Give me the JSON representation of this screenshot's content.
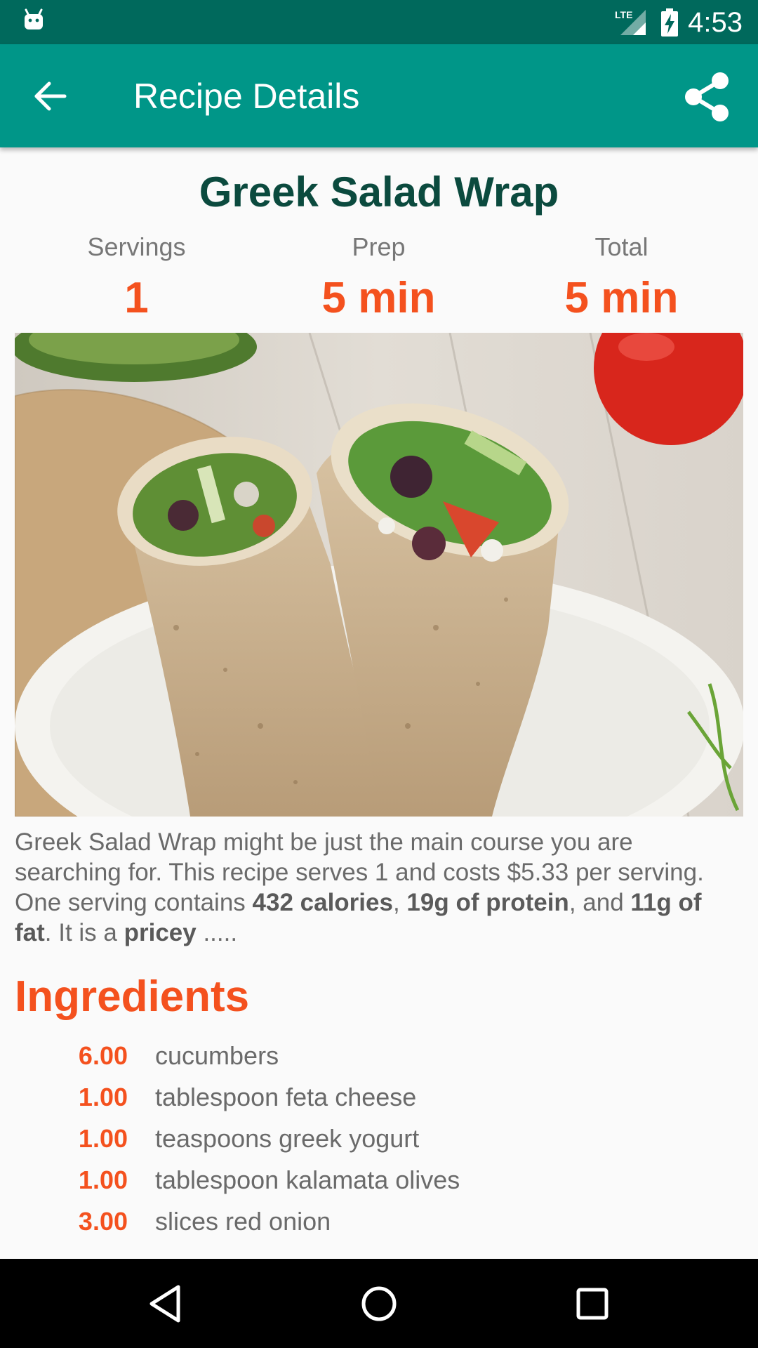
{
  "status_bar": {
    "time": "4:53",
    "network": "LTE",
    "icons": [
      "android-icon",
      "lte-signal-icon",
      "battery-charging-icon"
    ]
  },
  "app_bar": {
    "title": "Recipe Details",
    "back_icon": "arrow-back-icon",
    "share_icon": "share-icon",
    "color": "#009688",
    "status_color": "#00695c"
  },
  "recipe": {
    "title": "Greek Salad Wrap",
    "stats": [
      {
        "label": "Servings",
        "value": "1"
      },
      {
        "label": "Prep",
        "value": "5 min"
      },
      {
        "label": "Total",
        "value": "5 min"
      }
    ],
    "summary": {
      "part1": "Greek Salad Wrap might be just the main course you are searching for. This recipe serves 1 and costs $5.33 per serving. One serving contains ",
      "calories": "432 calories",
      "sep1": ", ",
      "protein": "19g of protein",
      "sep2": ", and ",
      "fat": "11g of fat",
      "part2": ". It is a ",
      "pricey": "pricey",
      "part3": " ....."
    },
    "ingredients_heading": "Ingredients",
    "ingredients": [
      {
        "qty": "6.00",
        "name": "cucumbers"
      },
      {
        "qty": "1.00",
        "name": "tablespoon feta cheese"
      },
      {
        "qty": "1.00",
        "name": "teaspoons greek yogurt"
      },
      {
        "qty": "1.00",
        "name": "tablespoon kalamata olives"
      },
      {
        "qty": "3.00",
        "name": "slices red onion"
      }
    ],
    "accent_color": "#f4511e",
    "title_color": "#0b4a3e"
  },
  "nav_bar": {
    "icons": [
      "back-triangle-icon",
      "home-circle-icon",
      "recents-square-icon"
    ]
  }
}
